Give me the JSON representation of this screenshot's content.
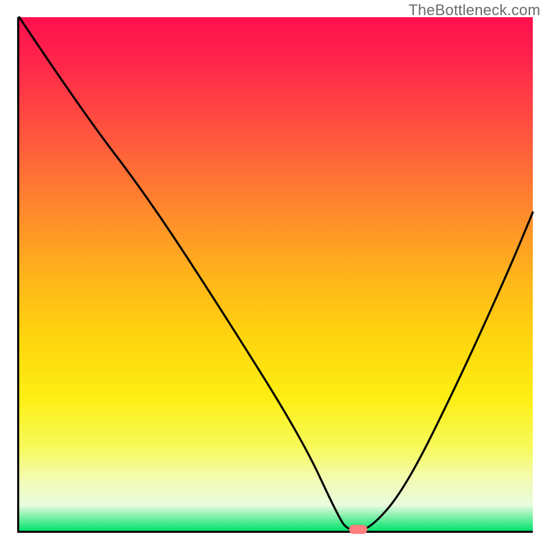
{
  "watermark": "TheBottleneck.com",
  "colors": {
    "curve": "#000000",
    "marker_fill": "#ff8080",
    "marker_stroke": "#ff6a6a",
    "axis": "#000000"
  },
  "chart_data": {
    "type": "line",
    "title": "",
    "xlabel": "",
    "ylabel": "",
    "xlim": [
      0,
      100
    ],
    "ylim": [
      0,
      100
    ],
    "grid": false,
    "annotations": [
      "TheBottleneck.com"
    ],
    "series": [
      {
        "name": "bottleneck-curve",
        "x": [
          0,
          12,
          25,
          40,
          55,
          62,
          64,
          68,
          75,
          85,
          95,
          100
        ],
        "y": [
          100,
          82,
          65,
          42,
          18,
          3,
          0,
          0,
          8,
          28,
          50,
          62
        ]
      }
    ],
    "markers": [
      {
        "name": "optimum-marker",
        "x": 66,
        "y": 0
      }
    ],
    "background_gradient": {
      "direction": "vertical",
      "stops": [
        {
          "pos": 0.0,
          "color": "#ff0f4e"
        },
        {
          "pos": 0.25,
          "color": "#ff5d3c"
        },
        {
          "pos": 0.5,
          "color": "#ffb31b"
        },
        {
          "pos": 0.74,
          "color": "#fdee12"
        },
        {
          "pos": 0.9,
          "color": "#f3fbb4"
        },
        {
          "pos": 1.0,
          "color": "#00e36b"
        }
      ]
    }
  }
}
